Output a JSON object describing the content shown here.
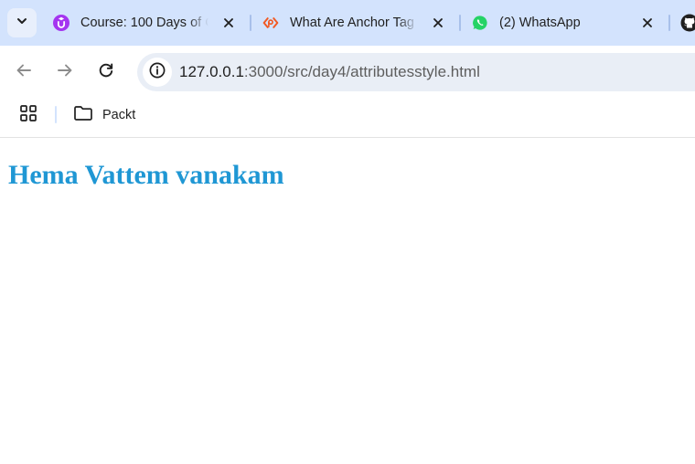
{
  "browser": {
    "tabs": [
      {
        "title": "Course: 100 Days of C",
        "favicon": "udemy-icon",
        "active": false
      },
      {
        "title": "What Are Anchor Tag",
        "favicon": "packt-icon",
        "active": false
      },
      {
        "title": "(2) WhatsApp",
        "favicon": "whatsapp-icon",
        "active": false
      }
    ],
    "address_bar": {
      "host": "127.0.0.1",
      "path": ":3000/src/day4/attributesstyle.html"
    },
    "bookmarks": [
      {
        "label": "Packt",
        "icon": "folder-icon"
      }
    ]
  },
  "page": {
    "heading": "Hema Vattem vanakam"
  },
  "colors": {
    "tabstrip_bg": "#d3e3fd",
    "omnibox_bg": "#e9eef6",
    "heading_color": "#1f97d4",
    "udemy_purple": "#a435f0",
    "packt_orange": "#f15a24",
    "whatsapp_green": "#25d366"
  }
}
